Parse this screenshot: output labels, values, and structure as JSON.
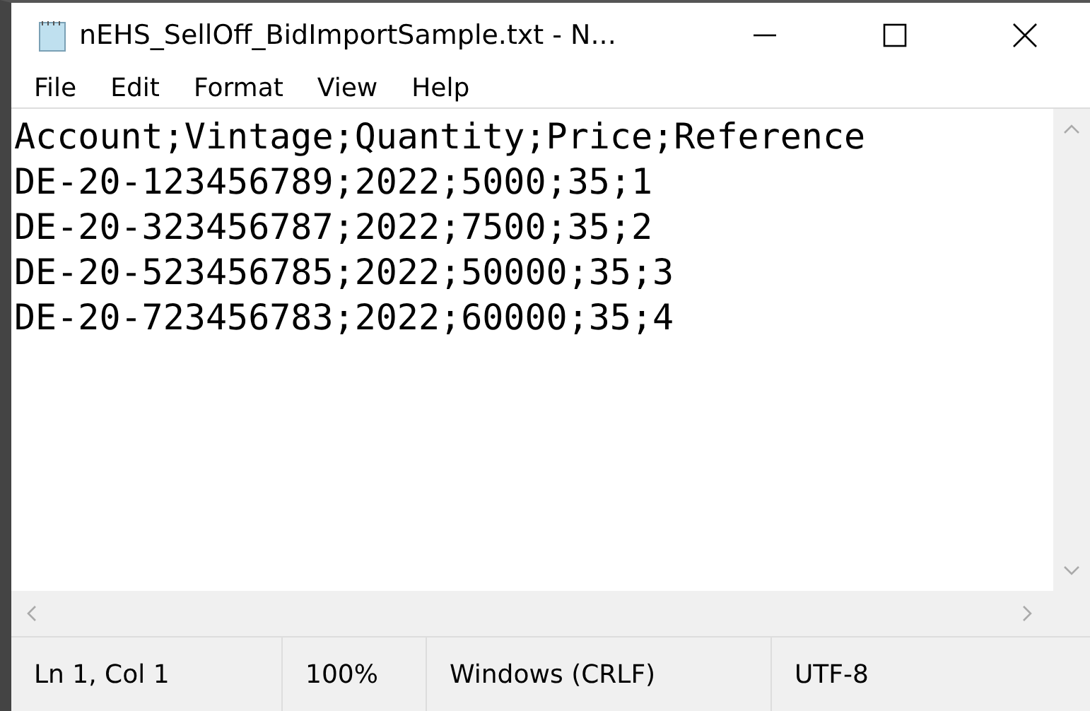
{
  "window": {
    "title": "nEHS_SellOff_BidImportSample.txt - N..."
  },
  "menu": [
    "File",
    "Edit",
    "Format",
    "View",
    "Help"
  ],
  "lines": [
    "Account;Vintage;Quantity;Price;Reference",
    "DE-20-123456789;2022;5000;35;1",
    "DE-20-323456787;2022;7500;35;2",
    "DE-20-523456785;2022;50000;35;3",
    "DE-20-723456783;2022;60000;35;4"
  ],
  "status_bar": [
    "Ln 1, Col 1",
    "100%",
    "Windows (CRLF)",
    "UTF-8"
  ]
}
